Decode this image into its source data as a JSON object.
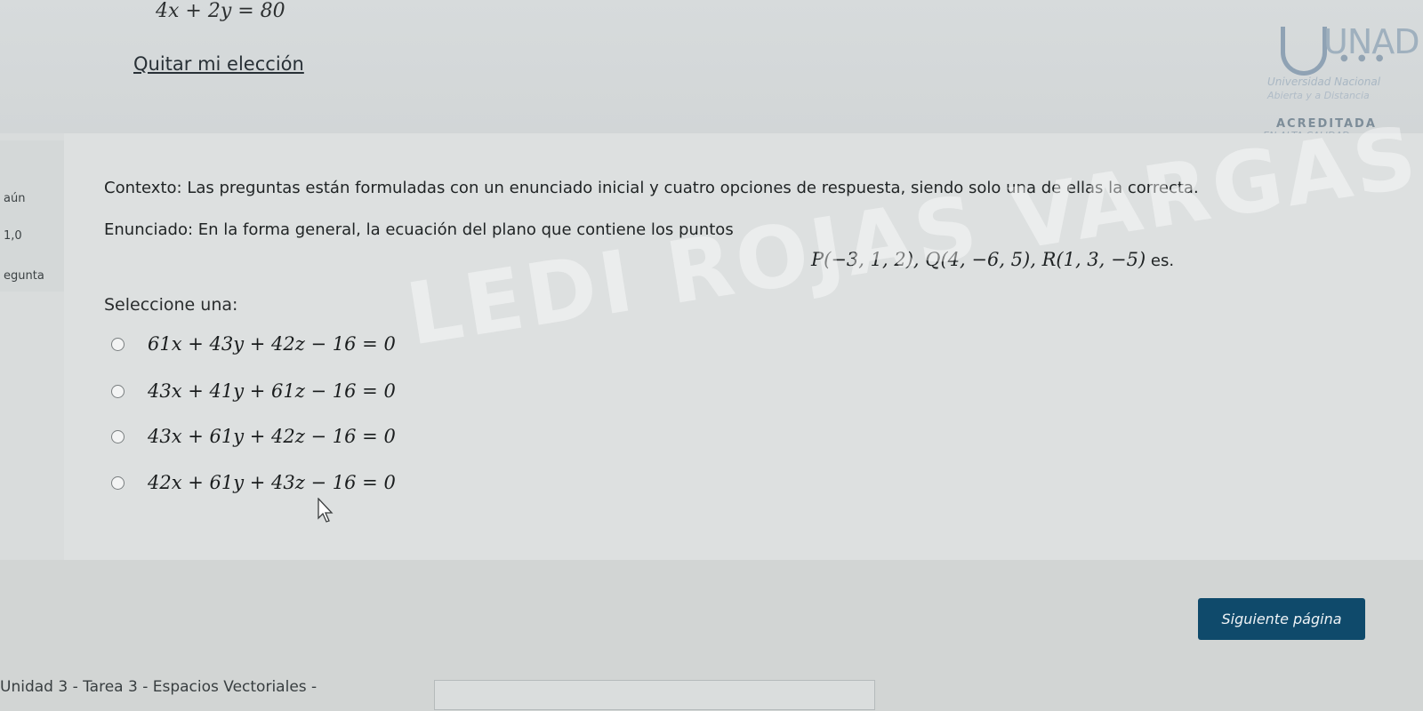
{
  "prev_question": {
    "equation": "4x + 2y = 80",
    "clear_choice": "Quitar mi elección"
  },
  "logo": {
    "word": "UNAD",
    "line1": "Universidad Nacional",
    "line2": "Abierta y a Distancia",
    "accredited": "ACREDITADA",
    "accredited_sub": "EN ALTA CALIDAD"
  },
  "info": {
    "status": "aún",
    "score": "1,0",
    "label": "egunta"
  },
  "question": {
    "context": "Contexto: Las preguntas están formuladas con un enunciado inicial y cuatro opciones de respuesta, siendo solo una de ellas la correcta.",
    "statement": "Enunciado: En la forma general, la ecuación del plano que contiene los puntos",
    "points": "P(−3, 1, 2),  Q(4, −6, 5),  R(1, 3, −5)",
    "points_suffix": "es.",
    "select_label": "Seleccione una:",
    "options": [
      "61x + 43y + 42z − 16 = 0",
      "43x + 41y + 61z − 16 = 0",
      "43x + 61y + 42z − 16 = 0",
      "42x + 61y + 43z − 16 = 0"
    ]
  },
  "watermark": "LEDI ROJAS VARGAS",
  "next_button": "Siguiente página",
  "footer": {
    "link": "Unidad 3 - Tarea 3 - Espacios Vectoriales -"
  }
}
